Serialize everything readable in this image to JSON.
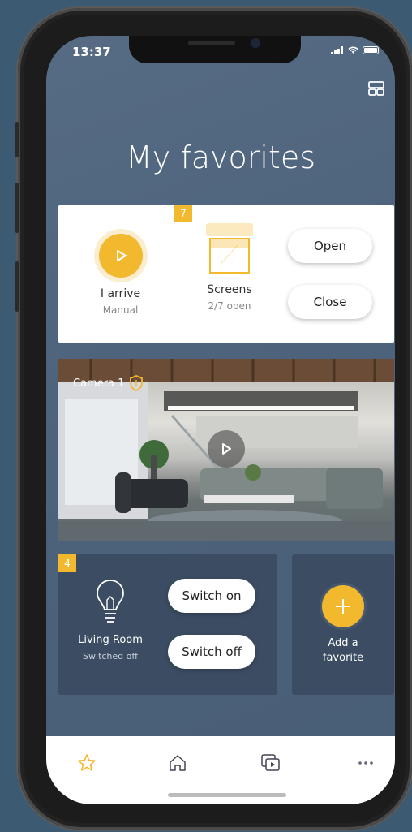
{
  "status": {
    "time": "13:37"
  },
  "page": {
    "title": "My favorites"
  },
  "cards": {
    "arrive": {
      "label": "I arrive",
      "sublabel": "Manual"
    },
    "screens": {
      "badge": "7",
      "label": "Screens",
      "sublabel": "2/7 open",
      "open_label": "Open",
      "close_label": "Close"
    },
    "camera": {
      "label": "Camera 1"
    },
    "living_room": {
      "badge": "4",
      "label": "Living Room",
      "sublabel": "Switched off",
      "switch_on_label": "Switch on",
      "switch_off_label": "Switch off"
    },
    "add_favorite": {
      "label_line1": "Add a",
      "label_line2": "favorite"
    }
  },
  "tabs": [
    {
      "icon": "star-icon",
      "active": true
    },
    {
      "icon": "home-icon",
      "active": false
    },
    {
      "icon": "media-icon",
      "active": false
    },
    {
      "icon": "more-icon",
      "active": false
    }
  ],
  "colors": {
    "accent": "#f2b82e",
    "background": "#4e637c",
    "card_dark": "#3c4d63"
  }
}
